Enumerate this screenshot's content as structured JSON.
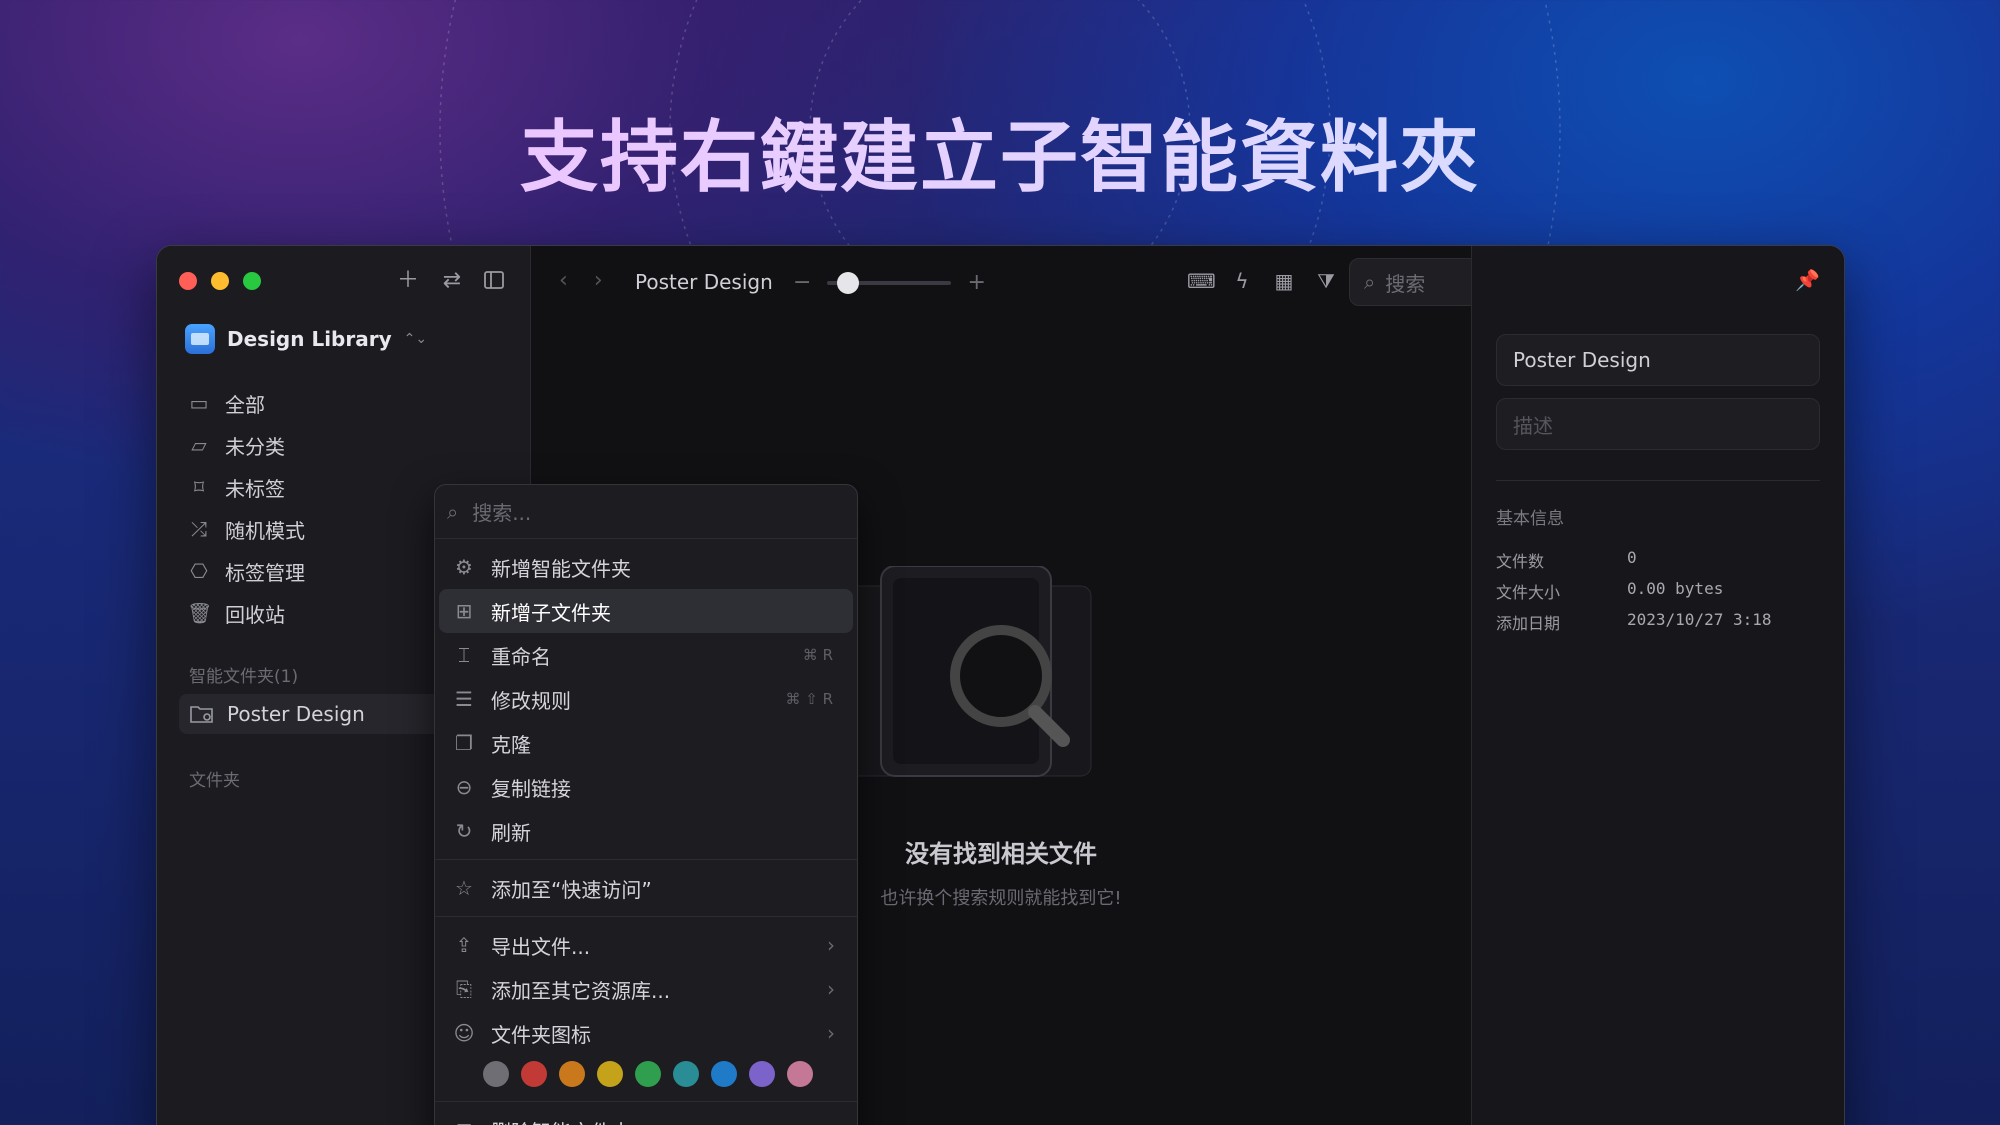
{
  "headline": "支持右鍵建立子智能資料夾",
  "window": {
    "traffic_colors": [
      "#ff5f57",
      "#febc2e",
      "#28c840"
    ],
    "sidebar": {
      "library_name": "Design Library",
      "items": [
        {
          "label": "全部",
          "icon": "inbox-icon"
        },
        {
          "label": "未分类",
          "icon": "folder-question-icon"
        },
        {
          "label": "未标签",
          "icon": "tag-question-icon"
        },
        {
          "label": "随机模式",
          "icon": "shuffle-icon"
        },
        {
          "label": "标签管理",
          "icon": "bookmark-icon"
        },
        {
          "label": "回收站",
          "icon": "trash-icon"
        }
      ],
      "smart_section": "智能文件夹(1)",
      "smart_item": "Poster Design",
      "folders_section": "文件夹"
    },
    "toolbar": {
      "folder_title": "Poster Design",
      "zoom_minus": "−",
      "zoom_plus": "+",
      "zoom_level": 0.12,
      "search_placeholder": "搜索"
    },
    "empty": {
      "title": "没有找到相关文件",
      "subtitle": "也许换个搜索规则就能找到它!"
    },
    "inspector": {
      "name_value": "Poster Design",
      "desc_placeholder": "描述",
      "info_heading": "基本信息",
      "rows": [
        {
          "label": "文件数",
          "value": "0"
        },
        {
          "label": "文件大小",
          "value": "0.00 bytes"
        },
        {
          "label": "添加日期",
          "value": "2023/10/27 3:18"
        }
      ]
    },
    "context_menu": {
      "search_placeholder": "搜索...",
      "items": [
        {
          "label": "新增智能文件夹",
          "icon": "smart-folder-add-icon",
          "shortcut": ""
        },
        {
          "label": "新增子文件夹",
          "icon": "folder-add-icon",
          "shortcut": "",
          "active": true
        },
        {
          "label": "重命名",
          "icon": "rename-icon",
          "shortcut": "⌘ R"
        },
        {
          "label": "修改规则",
          "icon": "rules-icon",
          "shortcut": "⌘ ⇧ R"
        },
        {
          "label": "克隆",
          "icon": "clone-icon",
          "shortcut": ""
        },
        {
          "label": "复制链接",
          "icon": "link-icon",
          "shortcut": ""
        },
        {
          "label": "刷新",
          "icon": "refresh-icon",
          "shortcut": ""
        }
      ],
      "quick_access": "添加至“快速访问”",
      "submenus": [
        {
          "label": "导出文件...",
          "icon": "export-icon"
        },
        {
          "label": "添加至其它资源库...",
          "icon": "library-add-icon"
        },
        {
          "label": "文件夹图标",
          "icon": "smiley-icon"
        }
      ],
      "swatch_colors": [
        "#6e6e74",
        "#c23a35",
        "#c9781c",
        "#c4a21a",
        "#2f9e4f",
        "#2a8c94",
        "#1f7ac8",
        "#7c63c9",
        "#c47896"
      ],
      "delete_label": "删除智能文件夹"
    }
  }
}
